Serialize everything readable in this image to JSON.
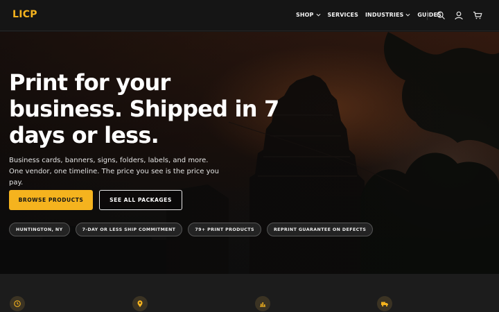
{
  "brand": {
    "logo": "LICP",
    "accent": "#f5b31e"
  },
  "nav": {
    "items": [
      {
        "label": "SHOP",
        "dropdown": true
      },
      {
        "label": "SERVICES",
        "dropdown": false
      },
      {
        "label": "INDUSTRIES",
        "dropdown": true
      },
      {
        "label": "GUIDES",
        "dropdown": false
      }
    ],
    "icons": [
      "search-icon",
      "user-icon",
      "cart-icon"
    ]
  },
  "hero": {
    "headline": "Print for your business. Shipped in 7 days or less.",
    "subtext": "Business cards, banners, signs, folders, labels, and more. One vendor, one timeline. The price you see is the price you pay.",
    "primary_button": "BROWSE PRODUCTS",
    "secondary_button": "SEE ALL PACKAGES",
    "pills": [
      "HUNTINGTON, NY",
      "7-DAY OR LESS SHIP COMMITMENT",
      "79+ PRINT PRODUCTS",
      "REPRINT GUARANTEE ON DEFECTS"
    ]
  },
  "features": {
    "icons": [
      "clock-icon",
      "location-pin-icon",
      "chart-icon",
      "truck-icon"
    ]
  }
}
